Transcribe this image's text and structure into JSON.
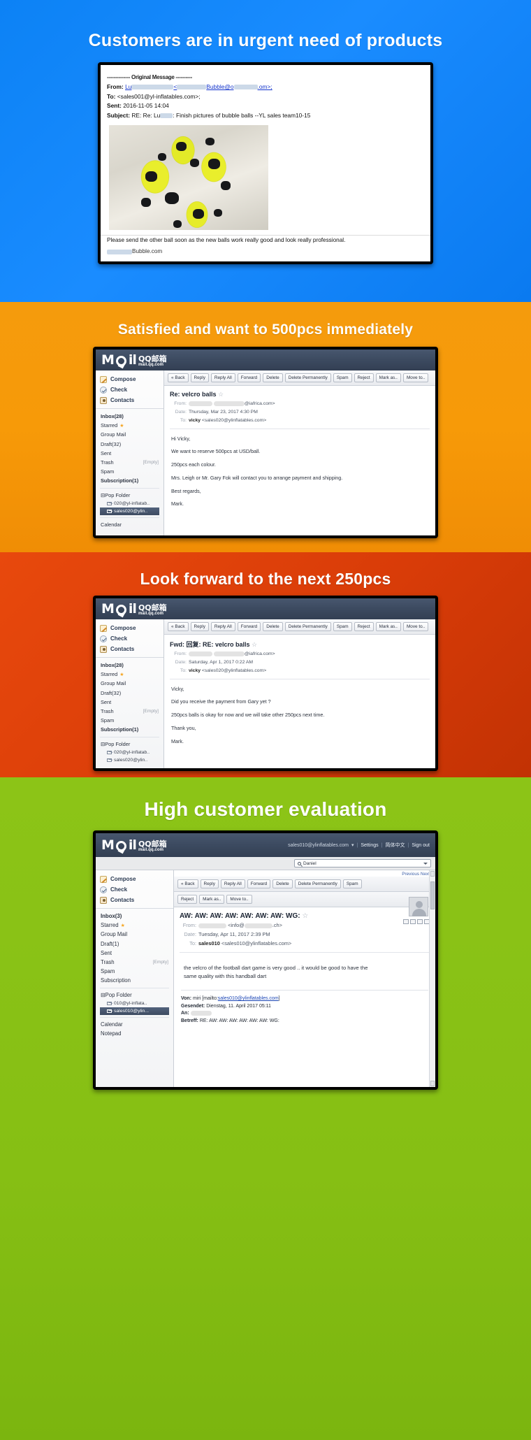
{
  "panels": [
    {
      "banner": "Customers are in urgent need of products",
      "bg": "#0c82f5",
      "email": {
        "separator": "-------------- Original Message ----------",
        "from_label": "From:",
        "from_value": "Lu",
        "from_value2": "Bubble@o",
        "from_value3": ".om>;",
        "to_label": "To:",
        "to_value": "<sales001@yl-inflatables.com>;",
        "sent_label": "Sent:",
        "sent_value": "2016-11-05 14:04",
        "subject_label": "Subject:",
        "subject_value": "RE: Re: Lu",
        "subject_value2": ": Finish pictures of bubble balls --YL sales team10-15",
        "body": "Please send the other ball soon as the new balls work really good and look really professional.",
        "signature": "Bubble.com",
        "image_alt": "yellow and black bubble soccer balls in a box"
      }
    },
    {
      "banner": "Satisfied  and want to 500pcs immediately",
      "bg": "#f59b0d",
      "mail": {
        "logo_text": "Mail",
        "logo_cn": "QQ邮箱",
        "logo_url": "mail.qq.com",
        "sidebar": {
          "actions": [
            {
              "label": "Compose",
              "icon": "pencil-icon"
            },
            {
              "label": "Check",
              "icon": "check-icon"
            },
            {
              "label": "Contacts",
              "icon": "contacts-icon"
            }
          ],
          "folders": [
            {
              "label": "Inbox(28)",
              "bold": true
            },
            {
              "label": "Starred",
              "star": true
            },
            {
              "label": "Group Mail"
            },
            {
              "label": "Draft(32)"
            },
            {
              "label": "Sent"
            },
            {
              "label": "Trash",
              "right": "[Empty]"
            },
            {
              "label": "Spam"
            },
            {
              "label": "Subscription(1)",
              "bold": true
            }
          ],
          "pop_folder_label": "Pop Folder",
          "pop_items": [
            {
              "label": "020@yl-inflatab..",
              "selected": false
            },
            {
              "label": "sales020@ylin..",
              "selected": true
            }
          ],
          "bottom": [
            "Calendar"
          ]
        },
        "toolbar": [
          "« Back",
          "Reply",
          "Reply All",
          "Forward",
          "Delete",
          "Delete Permanently",
          "Spam",
          "Reject",
          "Mark as..",
          "Move to.."
        ],
        "subject": "Re: velcro balls",
        "from_label": "From:",
        "from_value": "@iafrica.com>",
        "date_label": "Date:",
        "date_value": "Thursday, Mar 23, 2017 4:30 PM",
        "to_label": "To:",
        "to_name": "vicky",
        "to_value": "<sales020@ylinflatables.com>",
        "body": [
          "Hi Vicky,",
          "We want to reserve 500pcs at    USD/ball.",
          "250pcs each colour.",
          "Mrs. Leigh or Mr. Gary Fok will contact you to arrange payment and shipping.",
          "Best regards,",
          "Mark."
        ]
      }
    },
    {
      "banner": "Look forward to the next 250pcs",
      "bg": "#e8490d",
      "mail": {
        "logo_text": "Mail",
        "logo_cn": "QQ邮箱",
        "logo_url": "mail.qq.com",
        "sidebar": {
          "actions": [
            {
              "label": "Compose",
              "icon": "pencil-icon"
            },
            {
              "label": "Check",
              "icon": "check-icon"
            },
            {
              "label": "Contacts",
              "icon": "contacts-icon"
            }
          ],
          "folders": [
            {
              "label": "Inbox(28)",
              "bold": true
            },
            {
              "label": "Starred",
              "star": true
            },
            {
              "label": "Group Mail"
            },
            {
              "label": "Draft(32)"
            },
            {
              "label": "Sent"
            },
            {
              "label": "Trash",
              "right": "[Empty]"
            },
            {
              "label": "Spam"
            },
            {
              "label": "Subscription(1)",
              "bold": true
            }
          ],
          "pop_folder_label": "Pop Folder",
          "pop_items": [
            {
              "label": "020@yl-inflatab..",
              "selected": false
            },
            {
              "label": "sales020@ylin..",
              "selected": false
            }
          ],
          "bottom": []
        },
        "toolbar": [
          "« Back",
          "Reply",
          "Reply All",
          "Forward",
          "Delete",
          "Delete Permanently",
          "Spam",
          "Reject",
          "Mark as..",
          "Move to.."
        ],
        "subject": "Fwd: 回复: RE: velcro balls",
        "from_label": "From:",
        "from_value": "@iafrica.com>",
        "date_label": "Date:",
        "date_value": "Saturday, Apr 1, 2017 0:22 AM",
        "to_label": "To:",
        "to_name": "vicky",
        "to_value": "<sales020@ylinflatables.com>",
        "body": [
          "Vicky,",
          "Did you receive the payment from Gary yet ?",
          "250pcs balls is okay for now and we will take other 250pcs next time.",
          "Thank you,",
          "Mark."
        ]
      }
    },
    {
      "banner": "High customer evaluation",
      "bg": "#8cc417",
      "mail": {
        "logo_text": "Mail",
        "logo_cn": "QQ邮箱",
        "logo_url": "mail.qq.com",
        "account": "sales010@ylinflatables.com",
        "header_links": [
          "Settings",
          "简体中文",
          "Sign out"
        ],
        "search_value": "Daniel",
        "prev_label": "Previous",
        "next_label": "Next",
        "sidebar": {
          "actions": [
            {
              "label": "Compose",
              "icon": "pencil-icon"
            },
            {
              "label": "Check",
              "icon": "check-icon"
            },
            {
              "label": "Contacts",
              "icon": "contacts-icon"
            }
          ],
          "folders": [
            {
              "label": "Inbox(3)",
              "bold": true
            },
            {
              "label": "Starred",
              "star": true
            },
            {
              "label": "Group Mail"
            },
            {
              "label": "Draft(1)"
            },
            {
              "label": "Sent"
            },
            {
              "label": "Trash",
              "right": "[Empty]"
            },
            {
              "label": "Spam"
            },
            {
              "label": "Subscription"
            }
          ],
          "pop_folder_label": "Pop Folder",
          "pop_items": [
            {
              "label": "010@yl-inflata..",
              "selected": false
            },
            {
              "label": "sales010@ylin...",
              "selected": true
            }
          ],
          "bottom": [
            "Calendar",
            "Notepad"
          ]
        },
        "toolbar_row1": [
          "« Back",
          "Reply",
          "Reply All",
          "Forward",
          "Delete",
          "Delete Permanently",
          "Spam"
        ],
        "toolbar_row2": [
          "Reject",
          "Mark as..",
          "Move to.."
        ],
        "subject": "AW: AW: AW: AW: AW: AW: AW: WG:",
        "from_label": "From:",
        "from_value": "<info@",
        "from_value2": ".ch>",
        "date_label": "Date:",
        "date_value": "Tuesday, Apr 11, 2017 2:39 PM",
        "to_label": "To:",
        "to_name": "sales010",
        "to_value": "<sales010@ylinflatables.com>",
        "body": [
          "the velcro of the football dart game is very good .. it would be good to have the",
          "same quality with this handball dart"
        ],
        "quoted": [
          {
            "label": "Von:",
            "value": "miri [mailto:",
            "link": "sales010@ylinflatables.com",
            "tail": "]"
          },
          {
            "label": "Gesendet:",
            "value": "Dienstag, 11. April 2017 05:11"
          },
          {
            "label": "An:",
            "value": ""
          },
          {
            "label": "Betreff:",
            "value": "RE: AW: AW: AW: AW: AW: AW: WG:"
          }
        ]
      }
    }
  ]
}
